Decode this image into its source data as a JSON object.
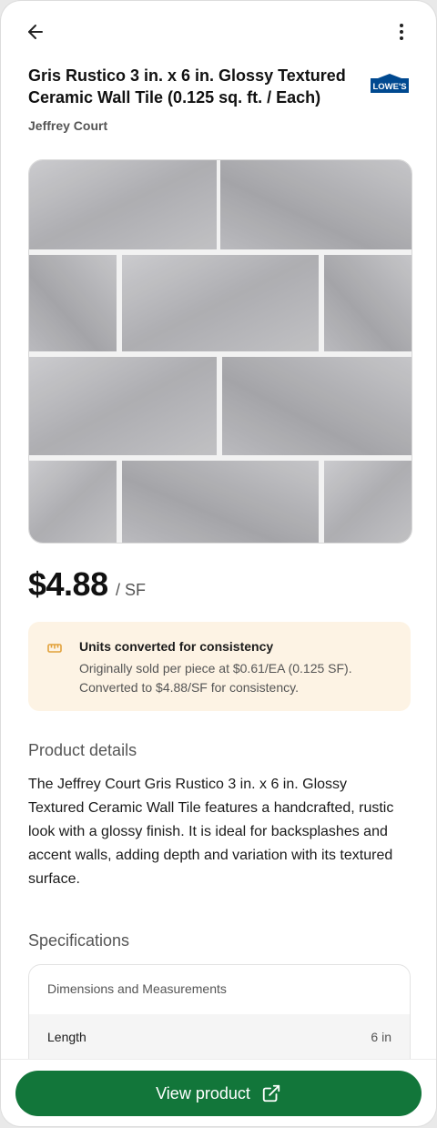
{
  "header": {
    "back_icon": "arrow-left-icon",
    "more_icon": "more-vertical-icon"
  },
  "product": {
    "title": "Gris Rustico 3 in. x 6 in. Glossy Textured Ceramic Wall Tile (0.125 sq. ft. / Each)",
    "brand": "Jeffrey Court",
    "retailer_logo_text": "LOWE'S",
    "price": "$4.88",
    "price_unit": "/ SF"
  },
  "conversion_note": {
    "icon": "ruler-icon",
    "title": "Units converted for consistency",
    "body": "Originally sold per piece at $0.61/EA (0.125 SF). Converted to $4.88/SF for consistency."
  },
  "details": {
    "heading": "Product details",
    "text": "The Jeffrey Court Gris Rustico 3 in. x 6 in. Glossy Textured Ceramic Wall Tile features a handcrafted, rustic look with a glossy finish. It is ideal for backsplashes and accent walls, adding depth and variation with its textured surface."
  },
  "specifications": {
    "heading": "Specifications",
    "group": "Dimensions and Measurements",
    "rows": [
      {
        "label": "Length",
        "value": "6 in"
      }
    ]
  },
  "footer": {
    "cta_label": "View product",
    "cta_icon": "external-link-icon"
  },
  "colors": {
    "cta": "#12763a",
    "note_bg": "#fdf3e4",
    "lowes_blue": "#004990"
  }
}
